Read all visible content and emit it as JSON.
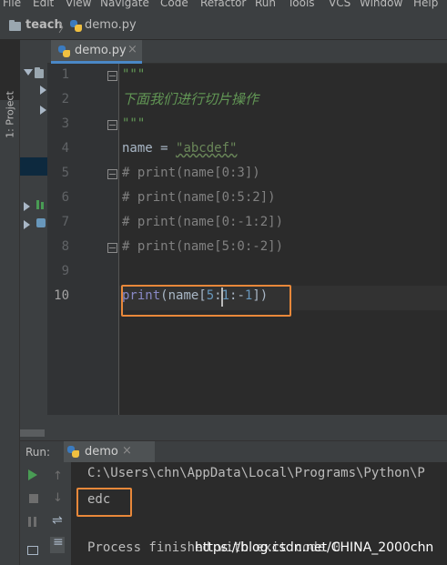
{
  "menu": [
    "File",
    "Edit",
    "View",
    "Navigate",
    "Code",
    "Refactor",
    "Run",
    "Tools",
    "VCS",
    "Window",
    "Help"
  ],
  "breadcrumb": {
    "project": "teach",
    "file": "demo.py"
  },
  "sidebar": {
    "project_tab": "1: Project"
  },
  "editor": {
    "tab_label": "demo.py",
    "close_glyph": "×",
    "line_numbers": [
      "1",
      "2",
      "3",
      "4",
      "5",
      "6",
      "7",
      "8",
      "9",
      "10"
    ],
    "current_line": "10",
    "lines": [
      {
        "parts": [
          {
            "t": "\"\"\"",
            "c": "doc"
          }
        ]
      },
      {
        "parts": [
          {
            "t": "下面我们进行切片操作",
            "c": "doc"
          }
        ]
      },
      {
        "parts": [
          {
            "t": "\"\"\"",
            "c": "doc"
          }
        ]
      },
      {
        "parts": [
          {
            "t": "name = ",
            "c": ""
          },
          {
            "t": "\"abcdef\"",
            "c": "str u"
          }
        ]
      },
      {
        "parts": [
          {
            "t": "# print(name[0:3])",
            "c": "cmt"
          }
        ]
      },
      {
        "parts": [
          {
            "t": "# print(name[0:5:2])",
            "c": "cmt"
          }
        ]
      },
      {
        "parts": [
          {
            "t": "# print(name[0:-1:2])",
            "c": "cmt"
          }
        ]
      },
      {
        "parts": [
          {
            "t": "# print(name[5:0:-2])",
            "c": "cmt"
          }
        ]
      },
      {
        "parts": []
      },
      {
        "parts": [
          {
            "t": "print",
            "c": "fn"
          },
          {
            "t": "(name[",
            "c": ""
          },
          {
            "t": "5",
            "c": "num"
          },
          {
            "t": ":",
            "c": ""
          },
          {
            "t": "1",
            "c": "num"
          },
          {
            "t": ":-",
            "c": ""
          },
          {
            "t": "1",
            "c": "num"
          },
          {
            "t": "])",
            "c": ""
          }
        ]
      }
    ]
  },
  "run": {
    "label": "Run:",
    "tab_label": "demo",
    "close_glyph": "×",
    "console": {
      "path_line": "C:\\Users\\chn\\AppData\\Local\\Programs\\Python\\P",
      "output": "edc",
      "finish_line": "Process finished with exit code 0"
    }
  },
  "watermark": "https://blog.csdn.net/CHINA_2000chn",
  "colors": {
    "accent_tab": "#4a88c7",
    "highlight_box": "#e8883a",
    "run_icon": "#499c54",
    "docstring": "#629755"
  }
}
